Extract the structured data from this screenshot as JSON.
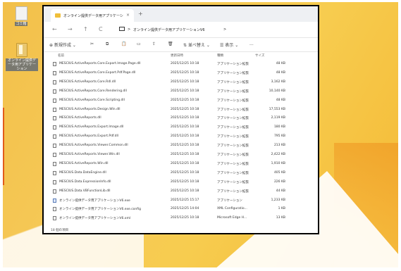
{
  "desktop": {
    "icons": [
      {
        "label": "ゴミ箱"
      },
      {
        "label": "オンライン提供データ用アプリケーション"
      }
    ]
  },
  "window": {
    "tab_title": "オンライン提供データ用アプリケーシ",
    "tab_close": "×",
    "new_tab": "+",
    "nav": {
      "back": "←",
      "forward": "→",
      "up": "↑",
      "refresh": "C"
    },
    "breadcrumb": [
      ">",
      "オンライン提供データ用アプリケーションV6",
      ">"
    ],
    "toolbar": {
      "new_label": "新規作成",
      "sort_label": "並べ替え",
      "view_label": "表示",
      "more_label": "..."
    },
    "columns": [
      "名前",
      "更新日時",
      "種類",
      "サイズ"
    ],
    "files": [
      {
        "name": "MESCIUS.ActiveReports.Core.Export.Image.Page.dll",
        "date": "2025/12/25 10:18",
        "type": "アプリケーション拡張",
        "size": "48 KB",
        "icon": "dll"
      },
      {
        "name": "MESCIUS.ActiveReports.Core.Export.Pdf.Page.dll",
        "date": "2025/12/25 10:18",
        "type": "アプリケーション拡張",
        "size": "48 KB",
        "icon": "dll"
      },
      {
        "name": "MESCIUS.ActiveReports.Core.Rdl.dll",
        "date": "2025/12/25 10:18",
        "type": "アプリケーション拡張",
        "size": "3,162 KB",
        "icon": "dll"
      },
      {
        "name": "MESCIUS.ActiveReports.Core.Rendering.dll",
        "date": "2025/12/25 10:18",
        "type": "アプリケーション拡張",
        "size": "10,140 KB",
        "icon": "dll"
      },
      {
        "name": "MESCIUS.ActiveReports.Core.Scripting.dll",
        "date": "2025/12/25 10:18",
        "type": "アプリケーション拡張",
        "size": "48 KB",
        "icon": "dll"
      },
      {
        "name": "MESCIUS.ActiveReports.Design.Win.dll",
        "date": "2025/12/25 10:18",
        "type": "アプリケーション拡張",
        "size": "17,553 KB",
        "icon": "dll"
      },
      {
        "name": "MESCIUS.ActiveReports.dll",
        "date": "2025/12/25 10:18",
        "type": "アプリケーション拡張",
        "size": "2,119 KB",
        "icon": "dll"
      },
      {
        "name": "MESCIUS.ActiveReports.Export.Image.dll",
        "date": "2025/12/25 10:18",
        "type": "アプリケーション拡張",
        "size": "180 KB",
        "icon": "dll"
      },
      {
        "name": "MESCIUS.ActiveReports.Export.Pdf.dll",
        "date": "2025/12/25 10:18",
        "type": "アプリケーション拡張",
        "size": "795 KB",
        "icon": "dll"
      },
      {
        "name": "MESCIUS.ActiveReports.Viewer.Common.dll",
        "date": "2025/12/25 10:18",
        "type": "アプリケーション拡張",
        "size": "213 KB",
        "icon": "dll"
      },
      {
        "name": "MESCIUS.ActiveReports.Viewer.Win.dll",
        "date": "2025/12/25 10:18",
        "type": "アプリケーション拡張",
        "size": "2,422 KB",
        "icon": "dll"
      },
      {
        "name": "MESCIUS.ActiveReports.Win.dll",
        "date": "2025/12/25 10:18",
        "type": "アプリケーション拡張",
        "size": "1,910 KB",
        "icon": "dll"
      },
      {
        "name": "MESCIUS.Data.DataEngine.dll",
        "date": "2025/12/25 10:18",
        "type": "アプリケーション拡張",
        "size": "405 KB",
        "icon": "dll"
      },
      {
        "name": "MESCIUS.Data.ExpressionInfo.dll",
        "date": "2025/12/25 10:18",
        "type": "アプリケーション拡張",
        "size": "226 KB",
        "icon": "dll"
      },
      {
        "name": "MESCIUS.Data.VBFunctionLib.dll",
        "date": "2025/12/25 10:18",
        "type": "アプリケーション拡張",
        "size": "44 KB",
        "icon": "dll"
      },
      {
        "name": "オンライン提供データ用アプリケーションV6.exe",
        "date": "2025/12/25 15:17",
        "type": "アプリケーション",
        "size": "1,233 KB",
        "icon": "app"
      },
      {
        "name": "オンライン提供データ用アプリケーションV6.exe.config",
        "date": "2025/12/25 14:04",
        "type": "XML Configuratio...",
        "size": "1 KB",
        "icon": "file"
      },
      {
        "name": "オンライン提供データ用アプリケーションV6.xml",
        "date": "2025/12/25 10:18",
        "type": "Microsoft Edge H...",
        "size": "13 KB",
        "icon": "file"
      }
    ],
    "status": "18 個の項目"
  }
}
